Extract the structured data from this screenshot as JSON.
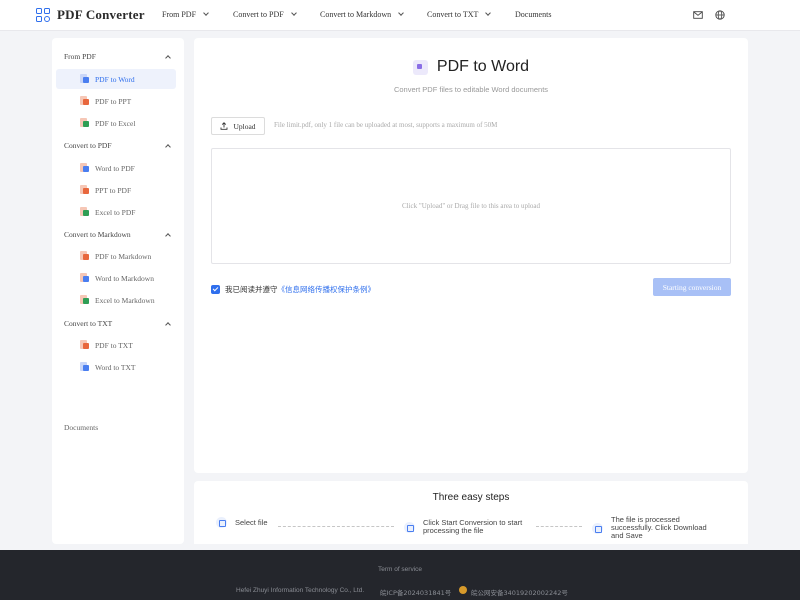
{
  "header": {
    "logo_text": "PDF Converter",
    "nav": [
      {
        "label": "From PDF",
        "dropdown": true
      },
      {
        "label": "Convert to PDF",
        "dropdown": true
      },
      {
        "label": "Convert to Markdown",
        "dropdown": true
      },
      {
        "label": "Convert to TXT",
        "dropdown": true
      },
      {
        "label": "Documents",
        "dropdown": false
      }
    ],
    "icons": [
      "mail-icon",
      "globe-icon"
    ]
  },
  "sidebar": {
    "sections": [
      {
        "title": "From PDF",
        "items": [
          {
            "label": "PDF to Word",
            "active": true
          },
          {
            "label": "PDF to PPT"
          },
          {
            "label": "PDF to Excel"
          }
        ]
      },
      {
        "title": "Convert to PDF",
        "items": [
          {
            "label": "Word to PDF"
          },
          {
            "label": "PPT to PDF"
          },
          {
            "label": "Excel to PDF"
          }
        ]
      },
      {
        "title": "Convert to Markdown",
        "items": [
          {
            "label": "PDF to Markdown"
          },
          {
            "label": "Word to Markdown"
          },
          {
            "label": "Excel to Markdown"
          }
        ]
      },
      {
        "title": "Convert to TXT",
        "items": [
          {
            "label": "PDF to TXT"
          },
          {
            "label": "Word to TXT"
          }
        ]
      }
    ],
    "documents_label": "Documents"
  },
  "main": {
    "title": "PDF to Word",
    "subtitle": "Convert PDF files to editable Word documents",
    "upload_label": "Upload",
    "file_limit": "File limit.pdf, only 1 file can be uploaded at most, supports a maximum of 50M",
    "dropzone_text": "Click \"Upload\" or Drag file to this area to upload",
    "agree_text": "我已阅读并遵守",
    "agree_link": "《信息网络传播权保护条例》",
    "agree_checked": true,
    "convert_label": "Starting conversion"
  },
  "steps": {
    "title": "Three easy steps",
    "items": [
      {
        "line1": "Select file",
        "line2": "",
        "line3": ""
      },
      {
        "line1": "Click Start Conversion to start",
        "line2": "processing the file",
        "line3": ""
      },
      {
        "line1": "The file is processed",
        "line2": "successfully. Click Download",
        "line3": "and Save"
      }
    ]
  },
  "footer": {
    "terms": "Term of service",
    "company": "Hefei Zhuyi Information Technology Co., Ltd.",
    "icp": "皖ICP备2024031841号",
    "police": "皖公网安备34019202002242号"
  },
  "colors": {
    "accent": "#2f6fed",
    "convert_disabled": "#a8c0f6",
    "footer_bg": "#24262c",
    "word_icon": "#4a7ef0",
    "ppt_icon": "#e8673d",
    "excel_icon": "#2f9e55",
    "markdown_icon": "#e8673d"
  }
}
